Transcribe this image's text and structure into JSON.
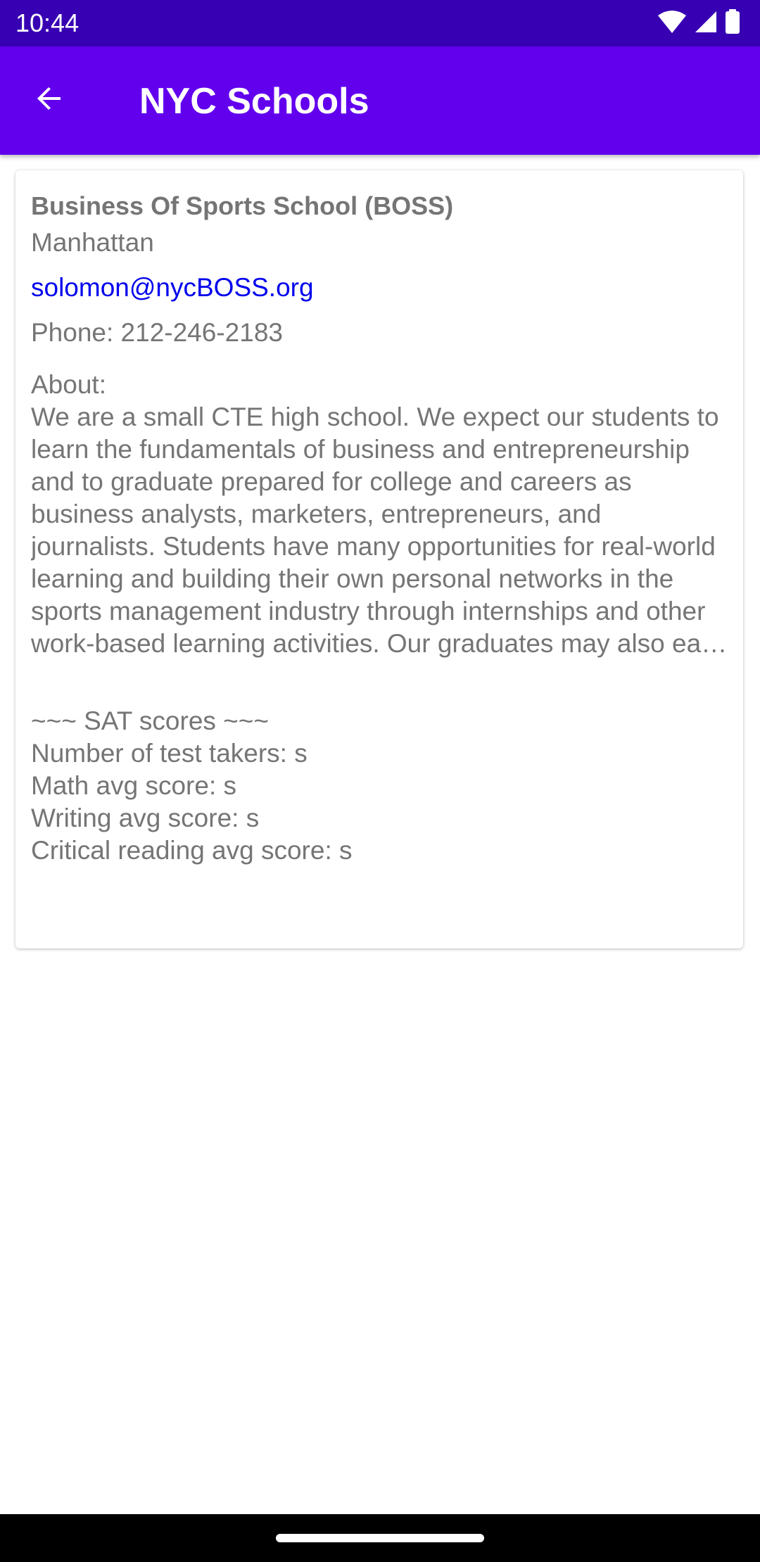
{
  "status_bar": {
    "time": "10:44",
    "icons": [
      "wifi-icon",
      "signal-icon",
      "battery-icon"
    ]
  },
  "app_bar": {
    "title": "NYC Schools",
    "back_icon": "arrow-back-icon"
  },
  "school": {
    "name": "Business Of Sports School (BOSS)",
    "borough": "Manhattan",
    "email": "solomon@nycBOSS.org",
    "phone": "Phone: 212-246-2183",
    "about_label": "About:",
    "about_text": "We are a small CTE high school. We expect our students to learn the fundamentals of business and entrepreneurship and to graduate prepared for college and careers as business analysts, marketers, entrepreneurs, and journalists. Students have many opportunities for real-world learning and building their own personal networks in the sports management industry through internships and other work-based learning activities. Our graduates may also earn industr…"
  },
  "sat": {
    "header": "~~~ SAT scores ~~~",
    "test_takers": "Number of test takers: s",
    "math": "Math avg score: s",
    "writing": "Writing avg score: s",
    "reading": "Critical reading avg score: s"
  },
  "colors": {
    "status_bar": "#3700b3",
    "app_bar": "#6200ee",
    "link": "#0000ee",
    "body_text": "#757575"
  }
}
